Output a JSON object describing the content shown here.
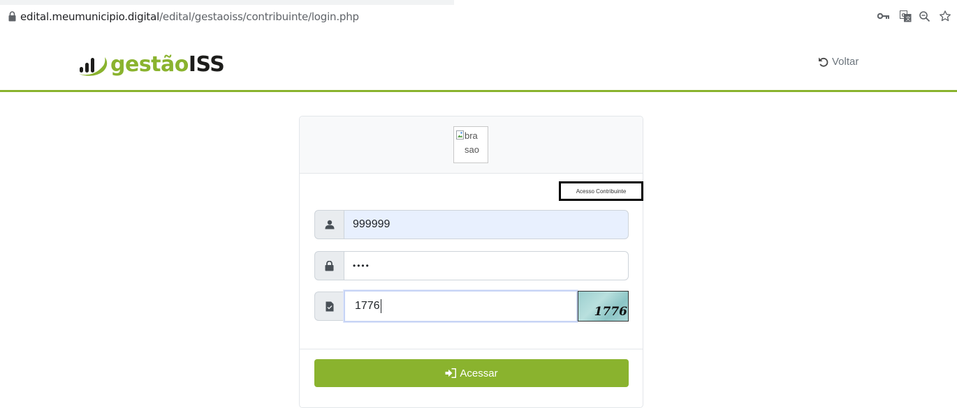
{
  "browser": {
    "url_domain": "edital.meumunicipio.digital",
    "url_path": "/edital/gestaoiss/contribuinte/login.php",
    "icons": [
      "lock-icon",
      "key-icon",
      "translate-icon",
      "zoom-icon",
      "star-icon"
    ]
  },
  "header": {
    "logo_text_light": "gestão",
    "logo_text_dark": "ISS",
    "back_label": "Voltar",
    "accent_color": "#8ab32e"
  },
  "card": {
    "brasao_alt_part1": "bra",
    "brasao_alt_part2": "sao",
    "access_label": "Acesso Contribuinte",
    "user_value": "999999",
    "password_value": "••••",
    "captcha_value": "1776",
    "captcha_image_text": "1776",
    "submit_label": "Acessar"
  }
}
